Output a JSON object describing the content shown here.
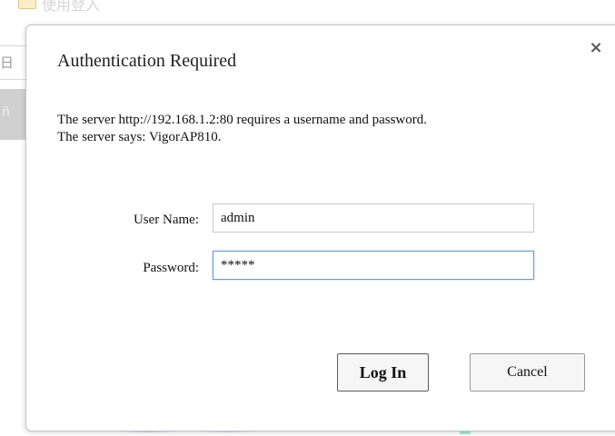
{
  "background": {
    "top_text": "使用登入",
    "edge_text_1": "日",
    "edge_text_2": "ñ"
  },
  "dialog": {
    "title": "Authentication Required",
    "close_glyph": "×",
    "message_line_1": "The server http://192.168.1.2:80 requires a username and password.",
    "message_line_2": "The server says: VigorAP810.",
    "username_label": "User Name:",
    "username_value": "admin",
    "password_label": "Password:",
    "password_value": "*****",
    "login_label": "Log In",
    "cancel_label": "Cancel"
  },
  "colors": {
    "focus_border": "#6a9ad6",
    "dialog_border": "#c4c4c4"
  }
}
